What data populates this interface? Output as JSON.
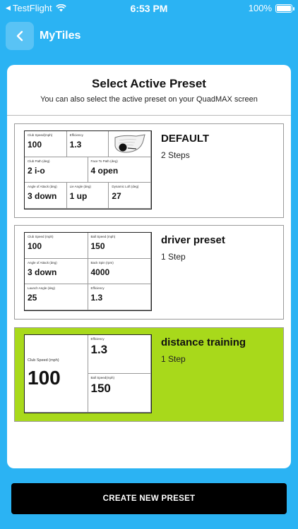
{
  "status_bar": {
    "back_app": "TestFlight",
    "time": "6:53 PM",
    "battery": "100%"
  },
  "nav": {
    "title": "MyTiles"
  },
  "card": {
    "title": "Select Active Preset",
    "subtitle": "You can also select the active preset on your QuadMAX screen"
  },
  "presets": [
    {
      "name": "DEFAULT",
      "steps": "2 Steps",
      "active": false,
      "tiles": [
        {
          "label": "Club Speed(mph)",
          "value": "100"
        },
        {
          "label": "Efficiency",
          "value": "1.3"
        },
        {
          "label": "Club Path (deg)",
          "value": "2 i-o"
        },
        {
          "label": "Face To Path (deg)",
          "value": "4 open"
        },
        {
          "label": "Angle of Attack (deg)",
          "value": "3 down"
        },
        {
          "label": "Lie Angle (deg)",
          "value": "1 up"
        },
        {
          "label": "Dynamic Loft (deg)",
          "value": "27"
        }
      ]
    },
    {
      "name": "driver preset",
      "steps": "1 Step",
      "active": false,
      "tiles": [
        {
          "label": "Club Speed (mph)",
          "value": "100"
        },
        {
          "label": "Ball Speed (mph)",
          "value": "150"
        },
        {
          "label": "Angle of Attack (deg)",
          "value": "3 down"
        },
        {
          "label": "Back Spin (rpm)",
          "value": "4000"
        },
        {
          "label": "Launch Angle (deg)",
          "value": "25"
        },
        {
          "label": "Efficiency",
          "value": "1.3"
        }
      ]
    },
    {
      "name": "distance training",
      "steps": "1 Step",
      "active": true,
      "tiles": [
        {
          "label": "Club Speed (mph)",
          "value": "100"
        },
        {
          "label": "Efficiency",
          "value": "1.3"
        },
        {
          "label": "Ball Speed(mph)",
          "value": "150"
        }
      ]
    }
  ],
  "create_button": {
    "label": "CREATE NEW PRESET"
  },
  "colors": {
    "background": "#2bb3f3",
    "active_preset": "#a8d91b",
    "button": "#000000"
  }
}
